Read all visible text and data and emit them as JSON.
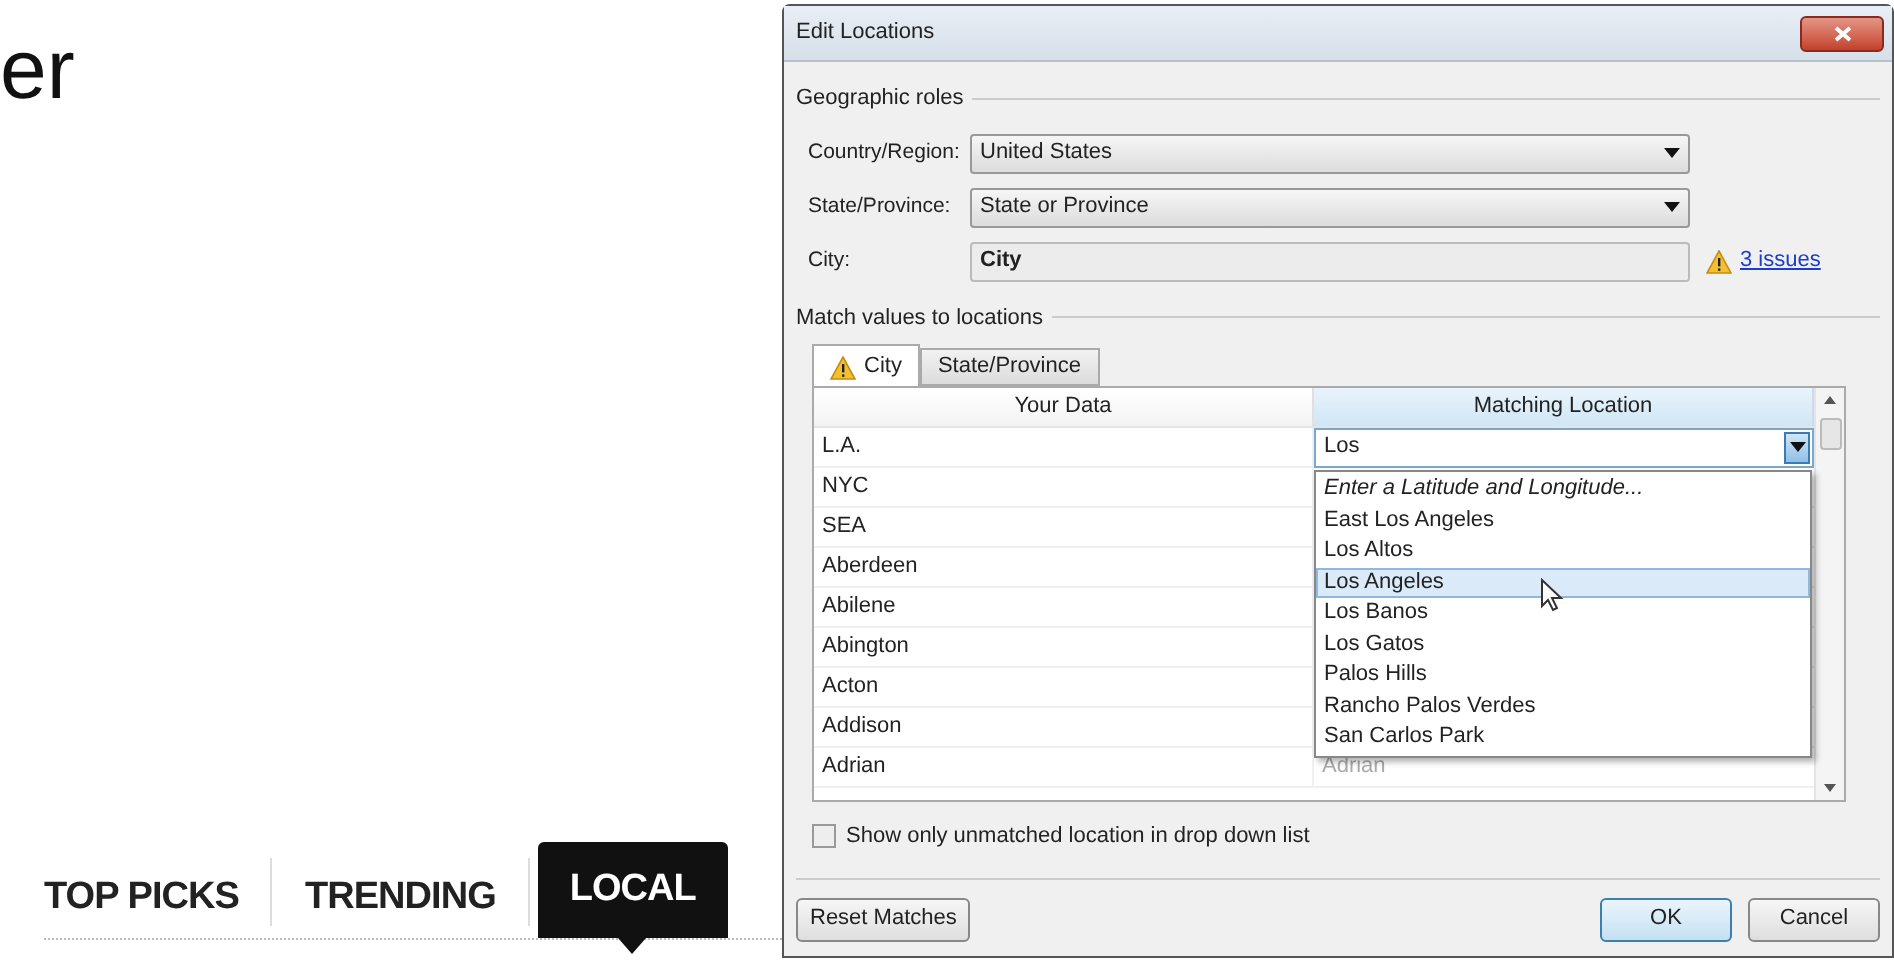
{
  "page": {
    "heading_fragment": "er",
    "tabs": [
      {
        "label": "TOP PICKS",
        "selected": false
      },
      {
        "label": "TRENDING",
        "selected": false
      },
      {
        "label": "LOCAL",
        "selected": true
      }
    ]
  },
  "dialog": {
    "title": "Edit Locations",
    "geographic_roles": {
      "legend": "Geographic roles",
      "fields": [
        {
          "label": "Country/Region:",
          "value": "United States",
          "kind": "dropdown"
        },
        {
          "label": "State/Province:",
          "value": "State or Province",
          "kind": "dropdown"
        },
        {
          "label": "City:",
          "value": "City",
          "kind": "text",
          "issues_link": "3 issues"
        }
      ]
    },
    "match": {
      "legend": "Match values to locations",
      "tabs": [
        {
          "label": "City",
          "selected": true,
          "warning": true
        },
        {
          "label": "State/Province",
          "selected": false,
          "warning": false
        }
      ],
      "columns": [
        "Your Data",
        "Matching Location"
      ],
      "rows": [
        {
          "your_data": "L.A.",
          "matching_location": "Los",
          "kind": "editing"
        },
        {
          "your_data": "NYC"
        },
        {
          "your_data": "SEA"
        },
        {
          "your_data": "Aberdeen"
        },
        {
          "your_data": "Abilene"
        },
        {
          "your_data": "Abington"
        },
        {
          "your_data": "Acton"
        },
        {
          "your_data": "Addison"
        },
        {
          "your_data": "Adrian",
          "matching_location": "Adrian",
          "kind": "suggested"
        }
      ],
      "dropdown_options": [
        {
          "label": "Enter a Latitude and Longitude...",
          "kind": "prompt",
          "selected": false
        },
        {
          "label": "East Los Angeles",
          "kind": "place",
          "selected": false
        },
        {
          "label": "Los Altos",
          "kind": "place",
          "selected": false
        },
        {
          "label": "Los Angeles",
          "kind": "place",
          "selected": true
        },
        {
          "label": "Los Banos",
          "kind": "place",
          "selected": false
        },
        {
          "label": "Los Gatos",
          "kind": "place",
          "selected": false
        },
        {
          "label": "Palos Hills",
          "kind": "place",
          "selected": false
        },
        {
          "label": "Rancho Palos Verdes",
          "kind": "place",
          "selected": false
        },
        {
          "label": "San Carlos Park",
          "kind": "place",
          "selected": false
        }
      ]
    },
    "checkbox": {
      "label": "Show only unmatched location in drop down list",
      "checked": false
    },
    "buttons": [
      {
        "label": "Reset Matches",
        "kind": "secondary"
      },
      {
        "label": "OK",
        "kind": "default"
      },
      {
        "label": "Cancel",
        "kind": "normal"
      }
    ]
  }
}
